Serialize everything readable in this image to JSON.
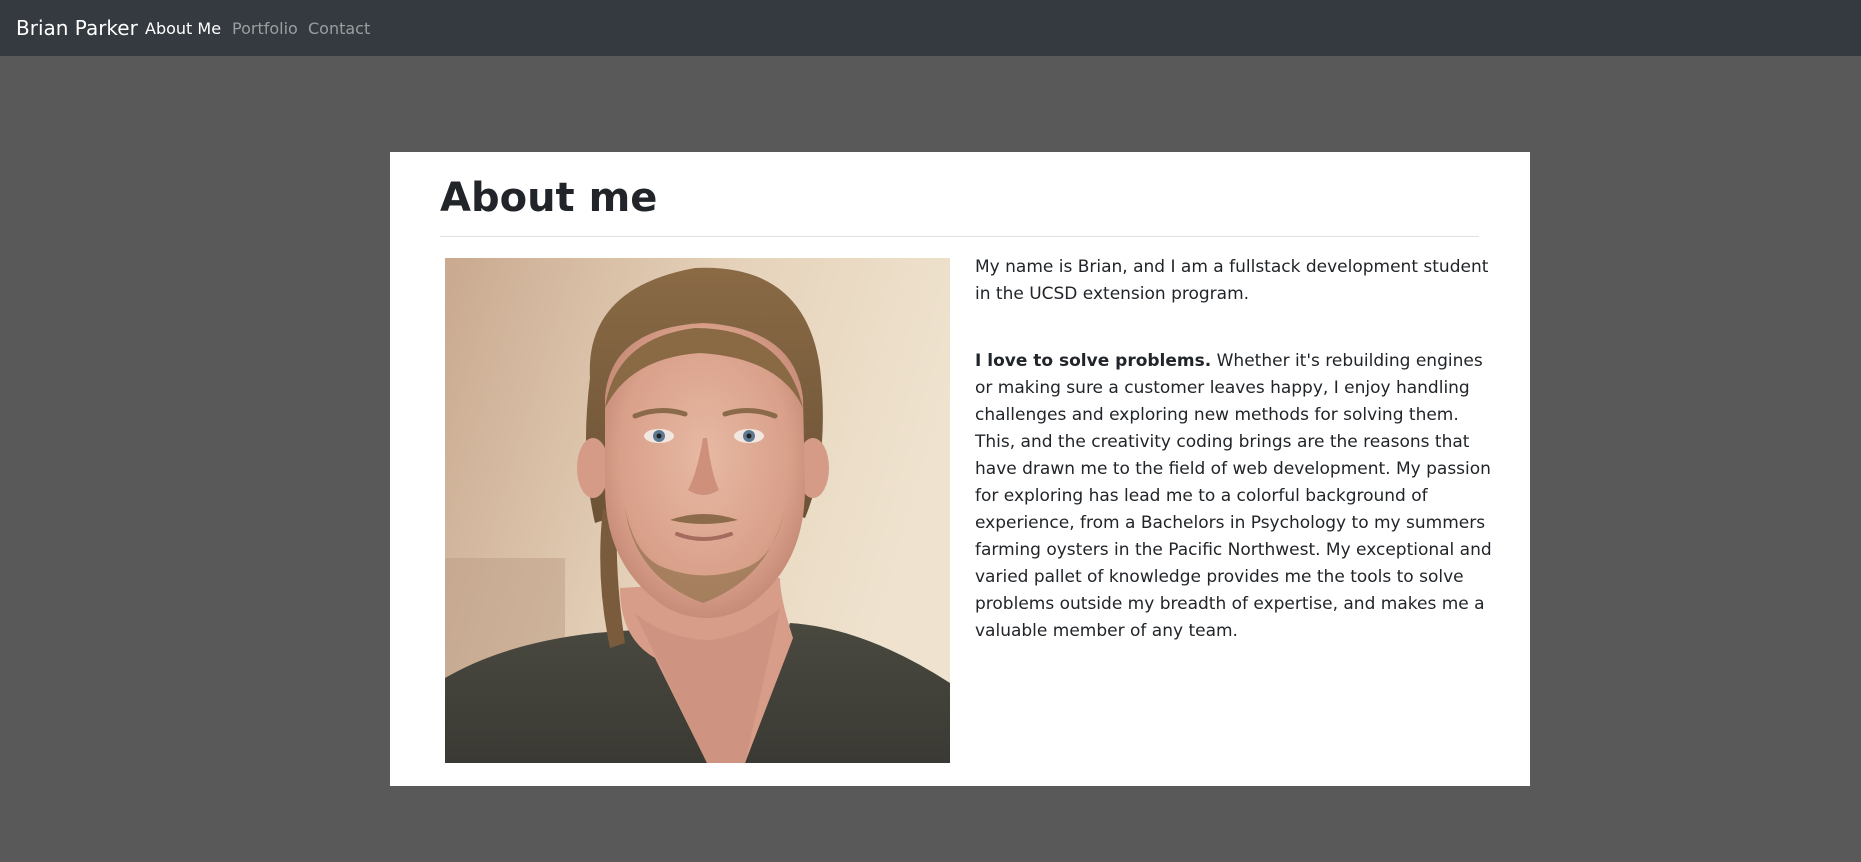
{
  "navbar": {
    "brand": "Brian Parker",
    "links": [
      {
        "label": "About Me",
        "active": true
      },
      {
        "label": "Portfolio",
        "active": false
      },
      {
        "label": "Contact",
        "active": false
      }
    ]
  },
  "about": {
    "title": "About me",
    "photo_alt": "Brian Parker",
    "intro": "My name is Brian, and I am a fullstack development student in the UCSD extension program.",
    "lead_bold": "I love to solve problems.",
    "body": " Whether it's rebuilding engines or making sure a customer leaves happy, I enjoy handling challenges and exploring new methods for solving them. This, and the creativity coding brings are the reasons that have drawn me to the field of web development. My passion for exploring has lead me to a colorful background of experience, from a Bachelors in Psychology to my summers farming oysters in the Pacific Northwest. My exceptional and varied pallet of knowledge provides me the tools to solve problems outside my breadth of expertise, and makes me a valuable member of any team."
  },
  "colors": {
    "page_background": "#595959",
    "navbar_background": "#343a40",
    "card_background": "#ffffff",
    "text": "#212529"
  }
}
